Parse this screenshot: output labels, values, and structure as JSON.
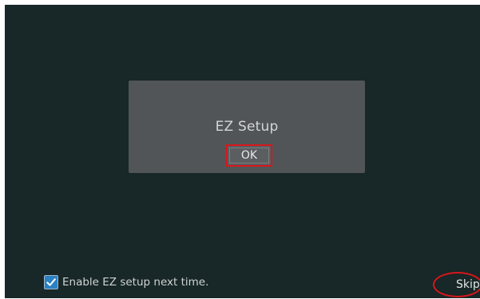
{
  "dialog": {
    "title": "EZ Setup",
    "ok_label": "OK"
  },
  "options": {
    "enable_ez_setup_label": "Enable EZ setup next time.",
    "enable_ez_setup_checked": true
  },
  "footer": {
    "skip_label": "Skip"
  },
  "colors": {
    "background": "#182727",
    "dialog": "#515557",
    "highlight": "#d8161c",
    "checkbox": "#2a81c4"
  },
  "icons": {
    "checkbox": "checkmark-icon"
  }
}
